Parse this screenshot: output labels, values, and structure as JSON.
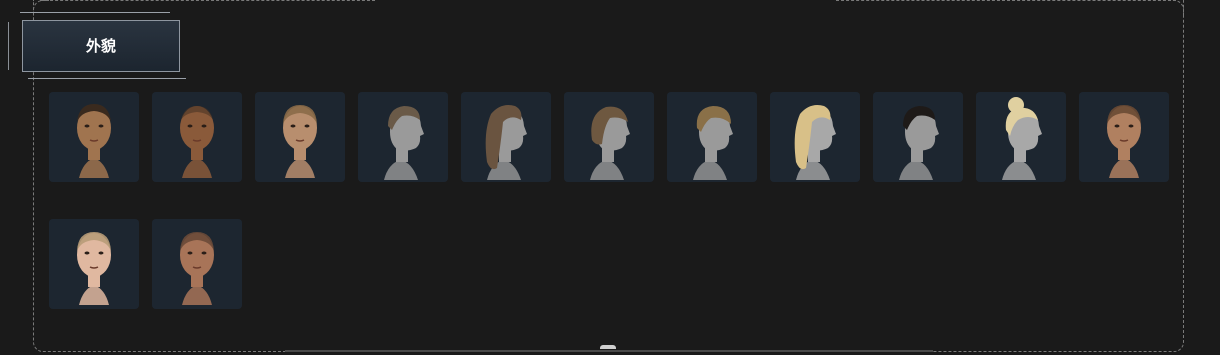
{
  "header": {
    "title": "外貌"
  },
  "appearance_grid": {
    "items": [
      {
        "name": "head-preset-male-1",
        "skin": "#a0744f",
        "hair": "#3a2a1e",
        "kind": "face-front-short"
      },
      {
        "name": "head-preset-male-2",
        "skin": "#8a5a3a",
        "hair": "#4a3424",
        "kind": "face-front-bald"
      },
      {
        "name": "head-preset-female-1",
        "skin": "#b88e6e",
        "hair": "#8a6a48",
        "kind": "face-front-buzz"
      },
      {
        "name": "hair-short-messy",
        "skin": "#9a9a9a",
        "hair": "#6a5a48",
        "kind": "profile-short"
      },
      {
        "name": "hair-long-wavy",
        "skin": "#9a9a9a",
        "hair": "#6a5440",
        "kind": "profile-long"
      },
      {
        "name": "hair-bob",
        "skin": "#9a9a9a",
        "hair": "#6e5840",
        "kind": "profile-bob"
      },
      {
        "name": "hair-bowl-cut",
        "skin": "#9a9a9a",
        "hair": "#8a7048",
        "kind": "profile-bowl"
      },
      {
        "name": "hair-wavy-blonde",
        "skin": "#a8a8a8",
        "hair": "#d8c088",
        "kind": "profile-wavy"
      },
      {
        "name": "hair-undercut",
        "skin": "#9a9a9a",
        "hair": "#1e1a18",
        "kind": "profile-undercut"
      },
      {
        "name": "hair-bun-blonde",
        "skin": "#a8a8a8",
        "hair": "#e0d0a0",
        "kind": "profile-bun"
      },
      {
        "name": "head-preset-female-2",
        "skin": "#b08060",
        "hair": "#6a4a34",
        "kind": "face-front-buzz"
      },
      {
        "name": "head-preset-female-3",
        "skin": "#e0b8a0",
        "hair": "#b89c78",
        "kind": "face-front-buzz"
      },
      {
        "name": "head-preset-female-4",
        "skin": "#a87458",
        "hair": "#6a4a38",
        "kind": "face-front-buzz"
      }
    ]
  },
  "scroll": {
    "position": 0.5
  }
}
